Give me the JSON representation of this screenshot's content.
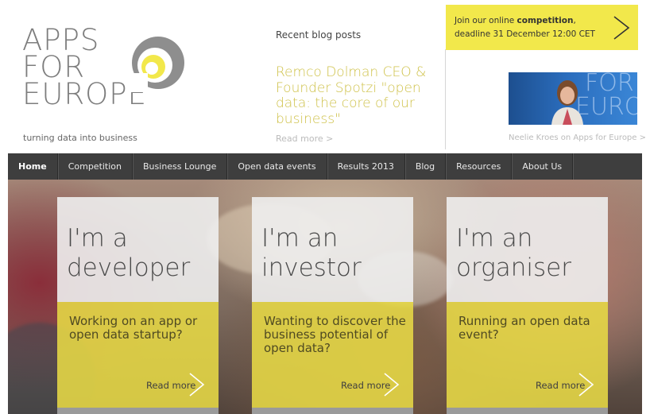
{
  "logo": {
    "line1": "APPS",
    "line2": "FOR",
    "line3": "EUROPE",
    "tagline": "turning data into business"
  },
  "blog": {
    "heading": "Recent blog posts",
    "title": "Remco Dolman CEO & Founder Spotzi \"open data: the core of our business\"",
    "read_more": "Read more >"
  },
  "competition": {
    "text_prefix": "Join our online ",
    "text_bold": "competition",
    "text_suffix": ", deadline 31 December 12:00 CET"
  },
  "video": {
    "caption": "Neelie Kroes on Apps for Europe >",
    "thumb_text_1": "FOR",
    "thumb_text_2": "EURO"
  },
  "nav": {
    "items": [
      {
        "label": "Home"
      },
      {
        "label": "Competition"
      },
      {
        "label": "Business Lounge"
      },
      {
        "label": "Open data events"
      },
      {
        "label": "Results 2013"
      },
      {
        "label": "Blog"
      },
      {
        "label": "Resources"
      },
      {
        "label": "About Us"
      }
    ]
  },
  "cards": [
    {
      "title_1": "I'm a",
      "title_2": "developer",
      "desc": "Working on an app or open data startup?",
      "more": "Read more"
    },
    {
      "title_1": "I'm an",
      "title_2": "investor",
      "desc": "Wanting to discover the business potential of open data?",
      "more": "Read more"
    },
    {
      "title_1": "I'm an",
      "title_2": "organiser",
      "desc": "Running an open data event?",
      "more": "Read more"
    }
  ],
  "colors": {
    "accent_yellow": "#f2e84b",
    "nav_bg": "#3e3e3e",
    "blog_title": "#cfc24a"
  }
}
